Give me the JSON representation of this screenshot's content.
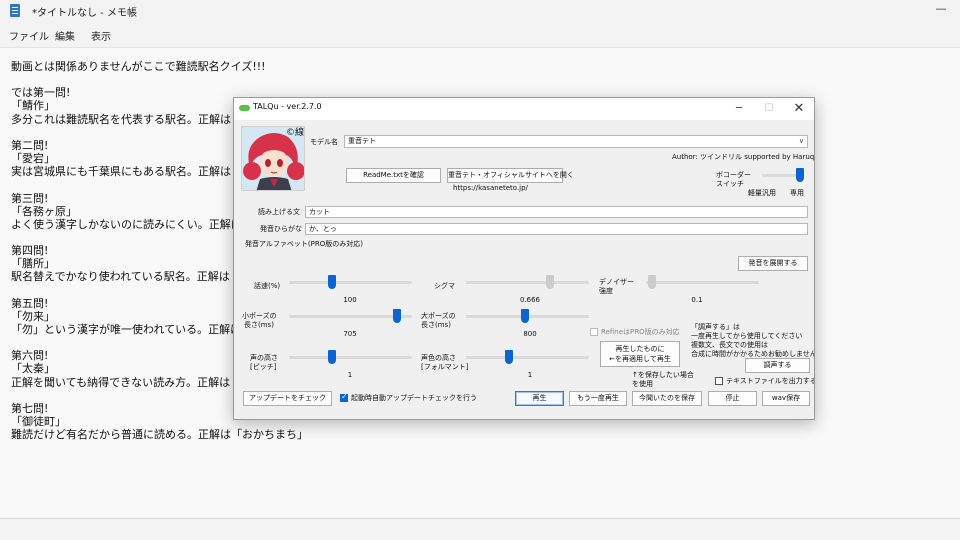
{
  "notepad": {
    "title": "*タイトルなし - メモ帳",
    "menu": [
      "ファイル",
      "編集",
      "表示"
    ],
    "lines": [
      "動画とは関係ありませんがここで難読駅名クイズ!!!",
      "",
      "では第一問!",
      "「鯖作」",
      "多分これは難読駅名を代表する駅名。正解は「",
      "",
      "第二問!",
      "「愛宕」",
      "実は宮城県にも千葉県にもある駅名。正解は「",
      "",
      "第三問!",
      "「各務ヶ原」",
      "よく使う漢字しかないのに読みにくい。正解は「",
      "",
      "第四問!",
      "「膳所」",
      "駅名替えでかなり使われている駅名。正解は「",
      "",
      "第五問!",
      "「勿来」",
      "「勿」という漢字が唯一使われている。正解は「",
      "",
      "第六問!",
      "「太秦」",
      "正解を聞いても納得できない読み方。正解は「",
      "",
      "第七問!",
      "「御徒町」",
      "難読だけど有名だから普通に読める。正解は「おかちまち」"
    ]
  },
  "dialog": {
    "title": "TALQu - ver.2.7.0",
    "copyright": "©線",
    "model_label": "モデル名",
    "model_value": "重音テト",
    "author": "Author: ツインドリル supported by Haruqa",
    "readme_button": "ReadMe.txtを確認",
    "site_button": "重音テト・オフィシャルサイトへを開く",
    "site_url": "https://kasaneteto.jp/",
    "vocoder_label_1": "ボコーダー",
    "vocoder_label_2": "スイッチ",
    "vocoder_left": "軽量汎用",
    "vocoder_right": "専用",
    "vocoder_value": 1.0,
    "read_text_label": "読み上げる文",
    "read_text_value": "カット",
    "hiragana_label": "発音ひらがな",
    "hiragana_value": "か、とっ",
    "alphabet_label": "発音アルファベット(PRO版のみ対応)",
    "expand_button": "発音を展開する",
    "sliders": {
      "speed": {
        "label": "話速(%)",
        "value": "100",
        "level": 0.35
      },
      "sigma": {
        "label": "シグマ",
        "value": "0.666",
        "level": 0.68
      },
      "denoiser": {
        "label_1": "デノイザー",
        "label_2": "強度",
        "value": "0.1",
        "level": 0.05
      },
      "short_pause": {
        "label_1": "小ポーズの",
        "label_2": "長さ(ms)",
        "value": "705",
        "level": 0.88
      },
      "long_pause": {
        "label_1": "大ポーズの",
        "label_2": "長さ(ms)",
        "value": "800",
        "level": 0.48
      },
      "pitch": {
        "label_1": "声の高さ",
        "label_2": "[ピッチ]",
        "value": "1",
        "level": 0.35
      },
      "formant": {
        "label_1": "声色の高さ",
        "label_2": "[フォルマント]",
        "value": "1",
        "level": 0.35
      }
    },
    "refine_label": "RefineはPRO版のみ対応",
    "reapply_button_1": "再生したものに",
    "reapply_button_2": "←を再適用して再生",
    "note_1": "「調声する」は",
    "note_2": "一度再生してから使用してください",
    "note_3": "複数文、長文での使用は",
    "note_4": "合成に時間がかかるためお勧めしません",
    "tune_button": "調声する",
    "save_note_1": "↑を保存したい場合",
    "save_note_2": "を使用",
    "text_file_label": "テキストファイルを出力する",
    "update_button": "アップデートをチェック",
    "auto_update_label": "起動時自動アップデートチェックを行う",
    "play_button": "再生",
    "replay_button": "もう一度再生",
    "save_heard_button": "今聞いたのを保存",
    "stop_button": "停止",
    "wav_save_button": "wav保存"
  }
}
